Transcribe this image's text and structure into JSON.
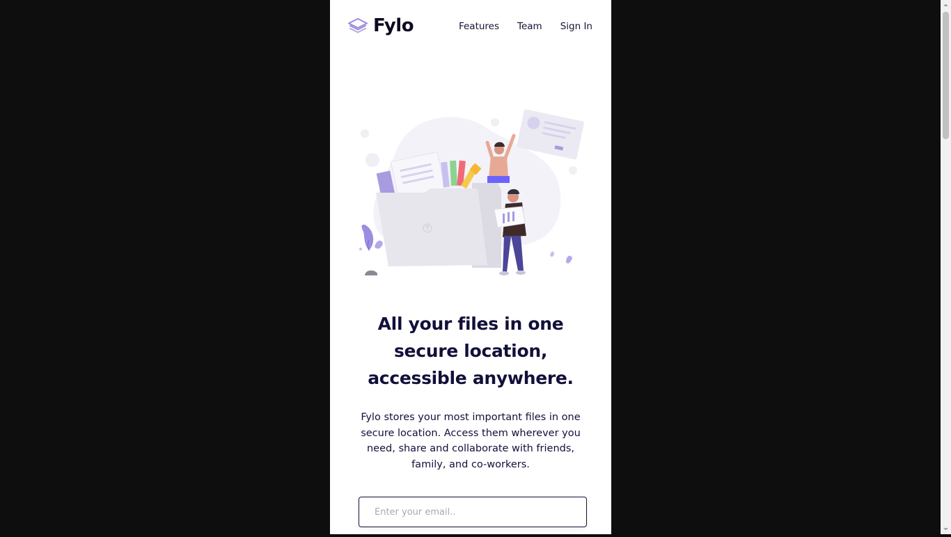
{
  "brand": {
    "name": "Fylo",
    "accent_color": "#9b8bd9"
  },
  "nav": {
    "links": [
      {
        "label": "Features"
      },
      {
        "label": "Team"
      },
      {
        "label": "Sign In"
      }
    ]
  },
  "hero": {
    "illustration": "people-storing-files-folder-illustration",
    "headline": "All your files in one secure location, accessible anywhere.",
    "description": "Fylo stores your most important files in one secure location. Access them wherever you need, share and collaborate with friends, family, and co-workers.",
    "email_placeholder": "Enter your email.."
  },
  "colors": {
    "background": "#0e0e0f",
    "page": "#ffffff",
    "text_dark": "#12103a"
  }
}
